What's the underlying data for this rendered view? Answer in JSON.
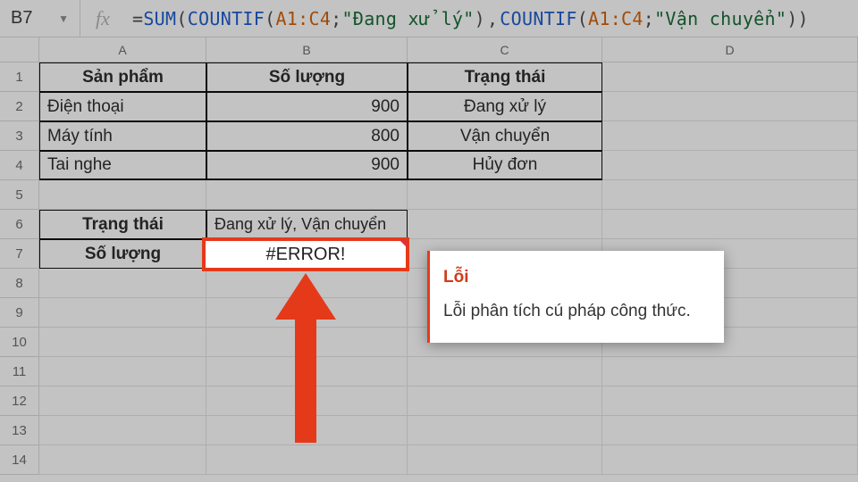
{
  "nameBox": "B7",
  "fx": "fx",
  "formula": {
    "pre": "=",
    "sum": "SUM",
    "op": "(",
    "c1": "COUNTIF",
    "p1": "(",
    "ref1": "A1:C4",
    "sc1": ";",
    "s1": "\"Đang xử lý\"",
    "p1c": ")",
    "sep": ",",
    "c2": "COUNTIF",
    "p2": "(",
    "ref2": "A1:C4",
    "sc2": ";",
    "s2": "\"Vận chuyển\"",
    "p2c": ")",
    "cl": ")"
  },
  "cols": {
    "A": "A",
    "B": "B",
    "C": "C",
    "D": "D"
  },
  "rows": {
    "r1": "1",
    "r2": "2",
    "r3": "3",
    "r4": "4",
    "r5": "5",
    "r6": "6",
    "r7": "7",
    "r8": "8",
    "r9": "9",
    "r10": "10",
    "r11": "11",
    "r12": "12",
    "r13": "13",
    "r14": "14"
  },
  "table": {
    "head": {
      "a": "Sản phẩm",
      "b": "Số lượng",
      "c": "Trạng thái"
    },
    "r1": {
      "a": "Điện thoại",
      "b": "900",
      "c": "Đang xử lý"
    },
    "r2": {
      "a": "Máy tính",
      "b": "800",
      "c": "Vận chuyển"
    },
    "r3": {
      "a": "Tai nghe",
      "b": "900",
      "c": "Hủy đơn"
    }
  },
  "lower": {
    "r6a": "Trạng thái",
    "r6b": "Đang xử lý, Vận chuyển",
    "r7a": "Số lượng",
    "r7b": "#ERROR!"
  },
  "tooltip": {
    "title": "Lỗi",
    "body": "Lỗi phân tích cú pháp công thức."
  },
  "chart_data": {
    "type": "table",
    "columns": [
      "Sản phẩm",
      "Số lượng",
      "Trạng thái"
    ],
    "rows": [
      [
        "Điện thoại",
        900,
        "Đang xử lý"
      ],
      [
        "Máy tính",
        800,
        "Vận chuyển"
      ],
      [
        "Tai nghe",
        900,
        "Hủy đơn"
      ]
    ]
  }
}
